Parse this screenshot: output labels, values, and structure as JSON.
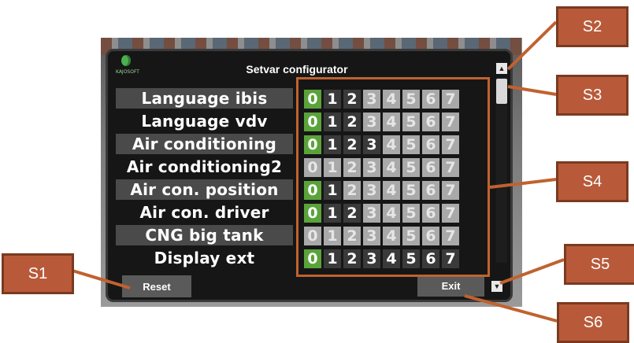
{
  "app": {
    "title": "Setvar configurator",
    "logo_text": "KAJOSOFT"
  },
  "settings": [
    {
      "label": "Language ibis",
      "selected": 0,
      "states": [
        "sel",
        "on",
        "on",
        "dis",
        "dis",
        "dis",
        "dis",
        "dis"
      ]
    },
    {
      "label": "Language vdv",
      "selected": 0,
      "states": [
        "sel",
        "on",
        "on",
        "dis",
        "dis",
        "dis",
        "dis",
        "dis"
      ]
    },
    {
      "label": "Air conditioning",
      "selected": 0,
      "states": [
        "sel",
        "on",
        "on",
        "on",
        "dis",
        "dis",
        "dis",
        "dis"
      ]
    },
    {
      "label": "Air conditioning2",
      "selected": null,
      "states": [
        "dis",
        "dis",
        "dis",
        "dis",
        "dis",
        "dis",
        "dis",
        "dis"
      ]
    },
    {
      "label": "Air con. position",
      "selected": 0,
      "states": [
        "sel",
        "on",
        "dis",
        "dis",
        "dis",
        "dis",
        "dis",
        "dis"
      ]
    },
    {
      "label": "Air con. driver",
      "selected": 0,
      "states": [
        "sel",
        "on",
        "on",
        "dis",
        "dis",
        "dis",
        "dis",
        "dis"
      ]
    },
    {
      "label": "CNG big tank",
      "selected": null,
      "states": [
        "dis",
        "dis",
        "dis",
        "dis",
        "dis",
        "dis",
        "dis",
        "dis"
      ]
    },
    {
      "label": "Display ext",
      "selected": 0,
      "states": [
        "sel",
        "on",
        "on",
        "on",
        "on",
        "on",
        "on",
        "on"
      ]
    }
  ],
  "option_values": [
    "0",
    "1",
    "2",
    "3",
    "4",
    "5",
    "6",
    "7"
  ],
  "buttons": {
    "reset": "Reset",
    "exit": "Exit"
  },
  "scroll": {
    "up_icon": "▲",
    "down_icon": "▼"
  },
  "callouts": {
    "s1": "S1",
    "s2": "S2",
    "s3": "S3",
    "s4": "S4",
    "s5": "S5",
    "s6": "S6"
  },
  "colors": {
    "selected": "#5aa33a",
    "callout": "#b85a3a",
    "highlight": "#c0622f"
  }
}
